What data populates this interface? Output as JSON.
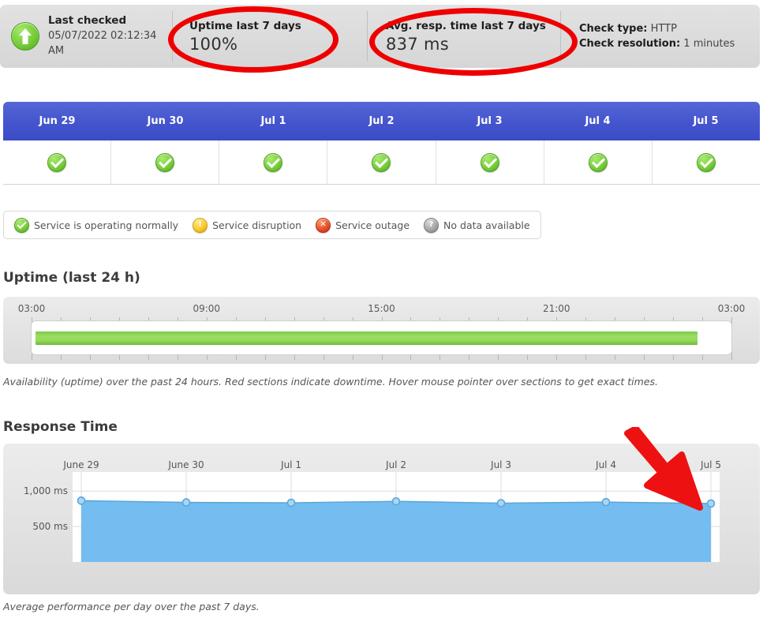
{
  "summary": {
    "status_icon": "arrow-up-icon",
    "last_checked_label": "Last checked",
    "last_checked_value": "05/07/2022 02:12:34 AM",
    "uptime_label": "Uptime last 7 days",
    "uptime_value": "100%",
    "resp_label": "Avg. resp. time last 7 days",
    "resp_value": "837 ms",
    "check_type_label": "Check type:",
    "check_type_value": "HTTP",
    "check_resolution_label": "Check resolution:",
    "check_resolution_value": "1 minutes"
  },
  "days": [
    {
      "label": "Jun 29",
      "status": "ok"
    },
    {
      "label": "Jun 30",
      "status": "ok"
    },
    {
      "label": "Jul 1",
      "status": "ok"
    },
    {
      "label": "Jul 2",
      "status": "ok"
    },
    {
      "label": "Jul 3",
      "status": "ok"
    },
    {
      "label": "Jul 4",
      "status": "ok"
    },
    {
      "label": "Jul 5",
      "status": "ok"
    }
  ],
  "legend": [
    {
      "icon": "check-circle-icon",
      "label": "Service is operating normally"
    },
    {
      "icon": "exclamation-circle-icon",
      "label": "Service disruption"
    },
    {
      "icon": "x-circle-icon",
      "label": "Service outage"
    },
    {
      "icon": "question-circle-icon",
      "label": "No data available"
    }
  ],
  "uptime_section": {
    "title": "Uptime (last 24 h)",
    "note": "Availability (uptime) over the past 24 hours. Red sections indicate downtime. Hover mouse pointer over sections to get exact times.",
    "bar_color": "#8ad44f"
  },
  "response_section": {
    "title": "Response Time",
    "note": "Average performance per day over the past 7 days."
  },
  "annotations": {
    "ellipse_color": "#ee0000",
    "arrow_color": "#ee1111",
    "ellipse_targets": [
      "Uptime last 7 days",
      "Avg. resp. time last 7 days"
    ],
    "arrow_target": "Jul 5"
  },
  "chart_data": [
    {
      "type": "bar",
      "name": "uptime-24h-timeline",
      "title": "Uptime (last 24 h)",
      "xlabel": "",
      "ylabel": "",
      "tick_labels": [
        "03:00",
        "09:00",
        "15:00",
        "21:00",
        "03:00"
      ],
      "tick_positions_pct": [
        0,
        25,
        50,
        75,
        100
      ],
      "hour_ticks": 24,
      "segments": [
        {
          "status": "up",
          "start_pct": 0,
          "end_pct": 95.7,
          "color": "#8ad44f"
        }
      ],
      "uptime_pct": 100
    },
    {
      "type": "area",
      "name": "response-time-7d",
      "title": "Response Time",
      "xlabel": "",
      "ylabel": "ms",
      "categories": [
        "June 29",
        "June 30",
        "Jul 1",
        "Jul 2",
        "Jul 3",
        "Jul 4",
        "Jul 5"
      ],
      "values": [
        865,
        840,
        835,
        855,
        830,
        845,
        825
      ],
      "ytick_labels": [
        "1,000 ms",
        "500 ms"
      ],
      "yticks": [
        1000,
        500
      ],
      "ylim": [
        0,
        1270
      ],
      "grid": true,
      "legend": "none",
      "line_color": "#5aa7dd",
      "fill_color": "#74bdf0",
      "marker_color": "#a9d6f2"
    }
  ]
}
